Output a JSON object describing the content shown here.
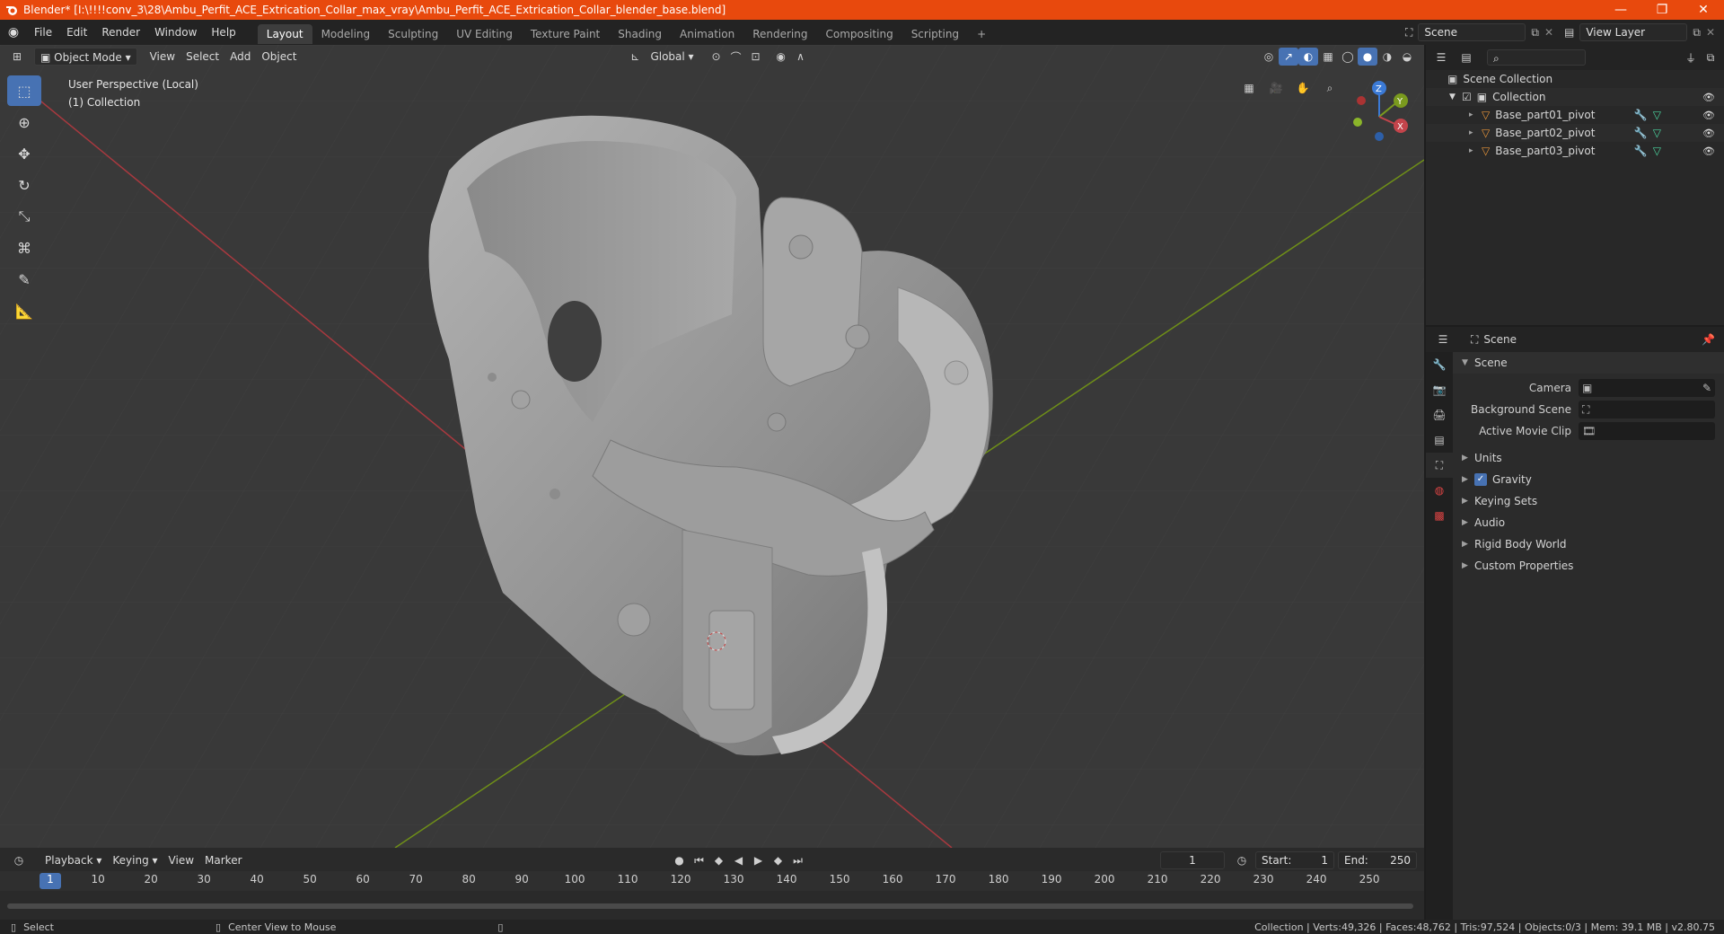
{
  "window": {
    "title": "Blender* [I:\\!!!!conv_3\\28\\Ambu_Perfit_ACE_Extrication_Collar_max_vray\\Ambu_Perfit_ACE_Extrication_Collar_blender_base.blend]",
    "minimize": "—",
    "maximize": "❐",
    "close": "✕"
  },
  "menu": [
    "File",
    "Edit",
    "Render",
    "Window",
    "Help"
  ],
  "workspaces": [
    "Layout",
    "Modeling",
    "Sculpting",
    "UV Editing",
    "Texture Paint",
    "Shading",
    "Animation",
    "Rendering",
    "Compositing",
    "Scripting"
  ],
  "active_workspace": "Layout",
  "add_tab": "+",
  "scene_field": "Scene",
  "view_layer_field": "View Layer",
  "viewport_header": {
    "mode": "Object Mode",
    "menus": [
      "View",
      "Select",
      "Add",
      "Object"
    ],
    "transform_orientation": "Global"
  },
  "viewport_info": {
    "line1": "User Perspective (Local)",
    "line2": "(1) Collection"
  },
  "gizmo": {
    "x": "X",
    "y": "Y",
    "z": "Z"
  },
  "outliner": {
    "root": "Scene Collection",
    "collection": "Collection",
    "objects": [
      "Base_part01_pivot",
      "Base_part02_pivot",
      "Base_part03_pivot"
    ]
  },
  "properties": {
    "header": "Scene",
    "section": "Scene",
    "camera_label": "Camera",
    "background_label": "Background Scene",
    "movieclip_label": "Active Movie Clip",
    "subsections": [
      "Units",
      "Gravity",
      "Keying Sets",
      "Audio",
      "Rigid Body World",
      "Custom Properties"
    ],
    "gravity_checked": true
  },
  "timeline": {
    "menus": [
      "Playback",
      "Keying",
      "View",
      "Marker"
    ],
    "current_frame": "1",
    "start_label": "Start:",
    "start_value": "1",
    "end_label": "End:",
    "end_value": "250",
    "ticks": [
      "1",
      "10",
      "20",
      "30",
      "40",
      "50",
      "60",
      "70",
      "80",
      "90",
      "100",
      "110",
      "120",
      "130",
      "140",
      "150",
      "160",
      "170",
      "180",
      "190",
      "200",
      "210",
      "220",
      "230",
      "240",
      "250"
    ]
  },
  "statusbar": {
    "select": "Select",
    "center": "Center View to Mouse",
    "stats": "Collection | Verts:49,326 | Faces:48,762 | Tris:97,524 | Objects:0/3 | Mem: 39.1 MB | v2.80.75"
  },
  "colors": {
    "titlebar": "#e8490d",
    "accent": "#4772b3",
    "x_axis": "#c4444b",
    "y_axis": "#7a9a1e",
    "z_axis": "#3b7ad6"
  }
}
